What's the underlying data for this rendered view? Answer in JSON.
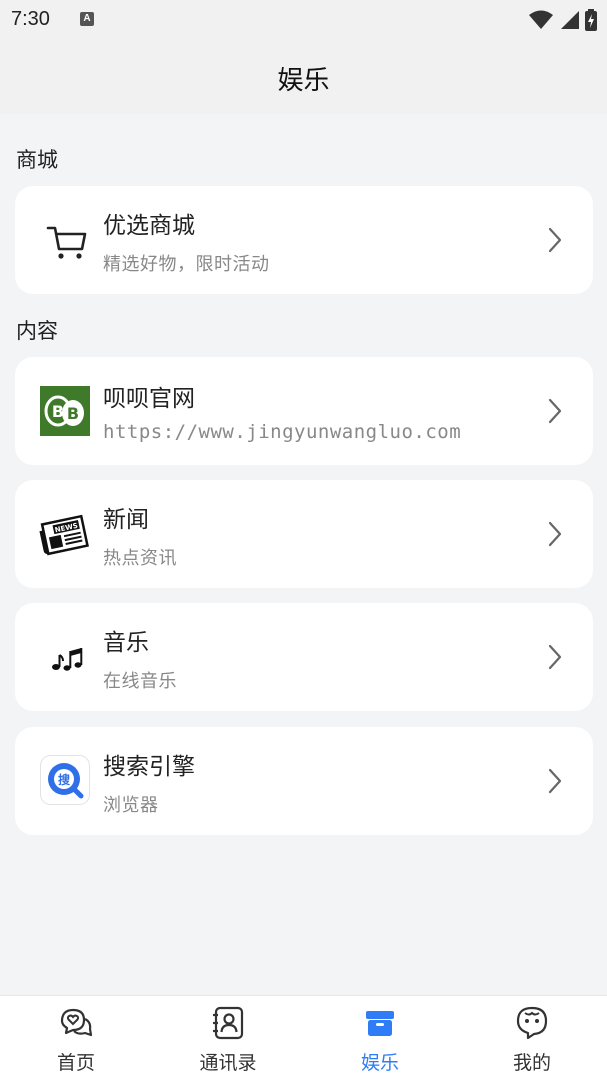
{
  "status": {
    "time": "7:30",
    "a_badge": "A"
  },
  "header": {
    "title": "娱乐"
  },
  "sections": [
    {
      "label": "商城"
    },
    {
      "label": "内容"
    }
  ],
  "items": [
    {
      "title": "优选商城",
      "subtitle": "精选好物，限时活动",
      "icon": "cart-icon"
    },
    {
      "title": "呗呗官网",
      "subtitle": "https://www.jingyunwangluo.com",
      "icon": "bb-logo-icon"
    },
    {
      "title": "新闻",
      "subtitle": "热点资讯",
      "icon": "newspaper-icon"
    },
    {
      "title": "音乐",
      "subtitle": "在线音乐",
      "icon": "music-notes-icon"
    },
    {
      "title": "搜索引擎",
      "subtitle": "浏览器",
      "icon": "search-app-icon"
    }
  ],
  "nav": [
    {
      "label": "首页",
      "icon": "home-chat-icon",
      "active": false
    },
    {
      "label": "通讯录",
      "icon": "contacts-icon",
      "active": false
    },
    {
      "label": "娱乐",
      "icon": "entertainment-box-icon",
      "active": true
    },
    {
      "label": "我的",
      "icon": "profile-bubble-icon",
      "active": false
    }
  ],
  "colors": {
    "accent": "#2f7cf6",
    "background": "#f3f4f6",
    "card": "#ffffff"
  }
}
